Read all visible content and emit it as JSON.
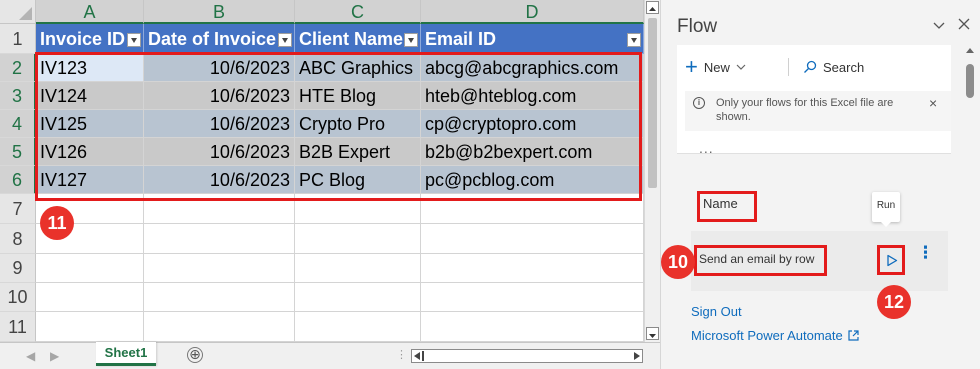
{
  "spreadsheet": {
    "column_letters": [
      "A",
      "B",
      "C",
      "D"
    ],
    "row_numbers": [
      "1",
      "2",
      "3",
      "4",
      "5",
      "6",
      "7",
      "8",
      "9",
      "10",
      "11"
    ],
    "table": {
      "headers": [
        "Invoice ID",
        "Date of Invoice",
        "Client Name",
        "Email ID"
      ],
      "rows": [
        [
          "IV123",
          "10/6/2023",
          "ABC Graphics",
          "abcg@abcgraphics.com"
        ],
        [
          "IV124",
          "10/6/2023",
          "HTE Blog",
          "hteb@hteblog.com"
        ],
        [
          "IV125",
          "10/6/2023",
          "Crypto Pro",
          "cp@cryptopro.com"
        ],
        [
          "IV126",
          "10/6/2023",
          "B2B Expert",
          "b2b@b2bexpert.com"
        ],
        [
          "IV127",
          "10/6/2023",
          "PC Blog",
          "pc@pcblog.com"
        ]
      ]
    },
    "sheet_tab": "Sheet1",
    "add_sheet_symbol": "⊕",
    "tab_dots": "⋮"
  },
  "annotations": {
    "badge_table": "11",
    "badge_flow_name": "10",
    "badge_run": "12"
  },
  "flow_pane": {
    "title": "Flow",
    "new_label": "New",
    "new_symbol": "+",
    "search_label": "Search",
    "notice_text": "Only your flows for this Excel file are shown.",
    "notice_info_symbol": "i",
    "notice_close_symbol": "×",
    "ellipsis": "...",
    "name_header": "Name",
    "run_tooltip": "Run",
    "flow_name": "Send an email by row",
    "more_symbol": "⋮",
    "sign_out": "Sign Out",
    "power_automate_link": "Microsoft Power Automate"
  },
  "colors": {
    "excel_green": "#217346",
    "table_header": "#4472c4",
    "annotation_red": "#e31b1b",
    "badge_red": "#e9322b",
    "link_blue": "#0f6cbd"
  },
  "icons": {
    "select_all": "corner-triangle-icon",
    "filter_dropdown": "filter-dropdown-icon",
    "new": "plus-icon",
    "search": "search-icon",
    "info": "info-icon",
    "run": "play-icon",
    "external_link": "external-link-icon"
  }
}
